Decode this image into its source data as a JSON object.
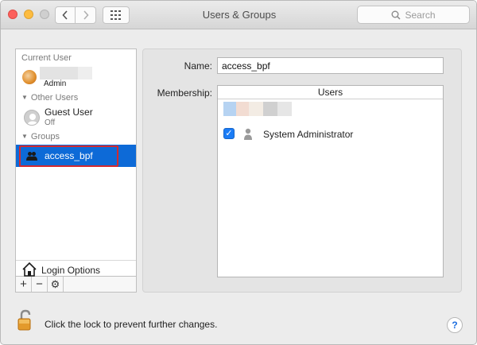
{
  "window": {
    "title": "Users & Groups",
    "search_placeholder": "Search"
  },
  "sidebar": {
    "current_user_label": "Current User",
    "current_user_role": "Admin",
    "other_users_label": "Other Users",
    "guest_name": "Guest User",
    "guest_status": "Off",
    "groups_label": "Groups",
    "selected_group": "access_bpf",
    "login_options": "Login Options",
    "tools": [
      "+",
      "−",
      "⚙"
    ]
  },
  "detail": {
    "name_label": "Name:",
    "name_value": "access_bpf",
    "membership_label": "Membership:",
    "members_column": "Users",
    "members": [
      {
        "name": "System Administrator",
        "checked": true
      }
    ]
  },
  "footer": {
    "lock_text": "Click the lock to prevent further changes.",
    "help": "?"
  }
}
